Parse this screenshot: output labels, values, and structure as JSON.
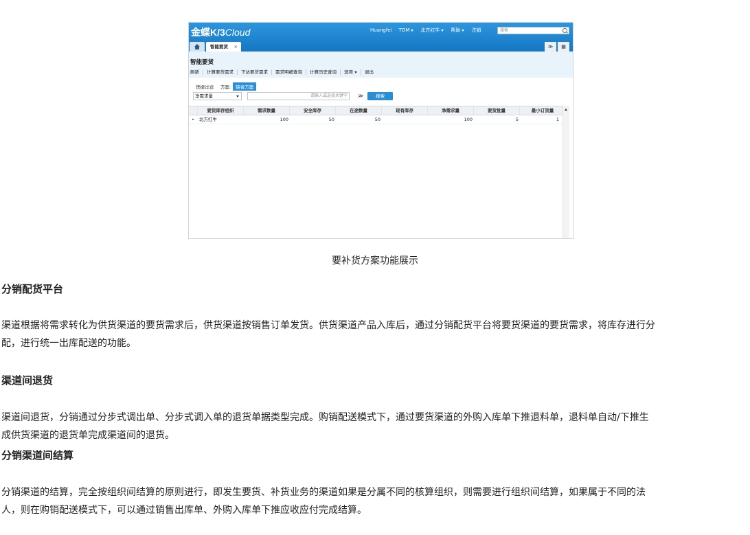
{
  "app": {
    "logo_brand": "金蝶K/3",
    "logo_cloud": "Cloud",
    "user_menu": {
      "username": "Huangfei",
      "tom": "TOM",
      "org": "北方红牛",
      "help": "帮助",
      "logout": "注销"
    },
    "search_placeholder": "搜索",
    "tabs": {
      "doc_tab_label": "智能要货",
      "doc_tab_close": "×"
    },
    "tab_tools": {
      "expand": "≫",
      "grid": "▦"
    },
    "page_title": "智能要货",
    "toolbar": [
      {
        "label": "刷新"
      },
      {
        "label": "计算要货需求"
      },
      {
        "label": "下达要货需求"
      },
      {
        "label": "需求明细查询"
      },
      {
        "label": "计算历史查询"
      },
      {
        "label": "选项"
      },
      {
        "label": "退出"
      }
    ],
    "filter": {
      "quick_filter": "快捷过滤",
      "scheme_label": "方案:",
      "scheme_value": "缺省方案"
    },
    "query": {
      "field_selected": "净需求量",
      "input_placeholder": "请输入或选择关键字",
      "expand": "≫",
      "search_button": "搜索"
    },
    "grid": {
      "columns": [
        "要货库存组织",
        "需求数量",
        "安全库存",
        "在途数量",
        "现有库存",
        "净需求量",
        "要货批量",
        "最小订货量"
      ],
      "rows": [
        {
          "indicator": "▸",
          "cells": [
            "北方红牛",
            "100",
            "50",
            "50",
            "",
            "100",
            "5",
            "1"
          ]
        }
      ]
    }
  },
  "caption": "要补货方案功能展示",
  "sections": [
    {
      "heading": "分销配货平台",
      "paragraph_line1": "渠道根据将需求转化为供货渠道的要货需求后，供货渠道按销售订单发货。供货渠道产品入库后，通过分销配货平台将要货渠道的要货需求，将库存进行分",
      "paragraph_line2": "配，进行统一出库配送的功能。"
    },
    {
      "heading": "渠道间退货",
      "paragraph_line1": "渠道间退货，分销通过分步式调出单、分步式调入单的退货单据类型完成。购销配送模式下，通过要货渠道的外购入库单下推退料单，退料单自动/下推生",
      "paragraph_line2": "成供货渠道的退货单完成渠道间的退货。"
    },
    {
      "heading": "分销渠道间结算",
      "paragraph_line1": "分销渠道的结算，完全按组织间结算的原则进行，即发生要货、补货业务的渠道如果是分属不同的核算组织，则需要进行组织间结算，如果属于不同的法",
      "paragraph_line2": "人，则在购销配送模式下，可以通过销售出库单、外购入库单下推应收应付完成结算。"
    }
  ]
}
